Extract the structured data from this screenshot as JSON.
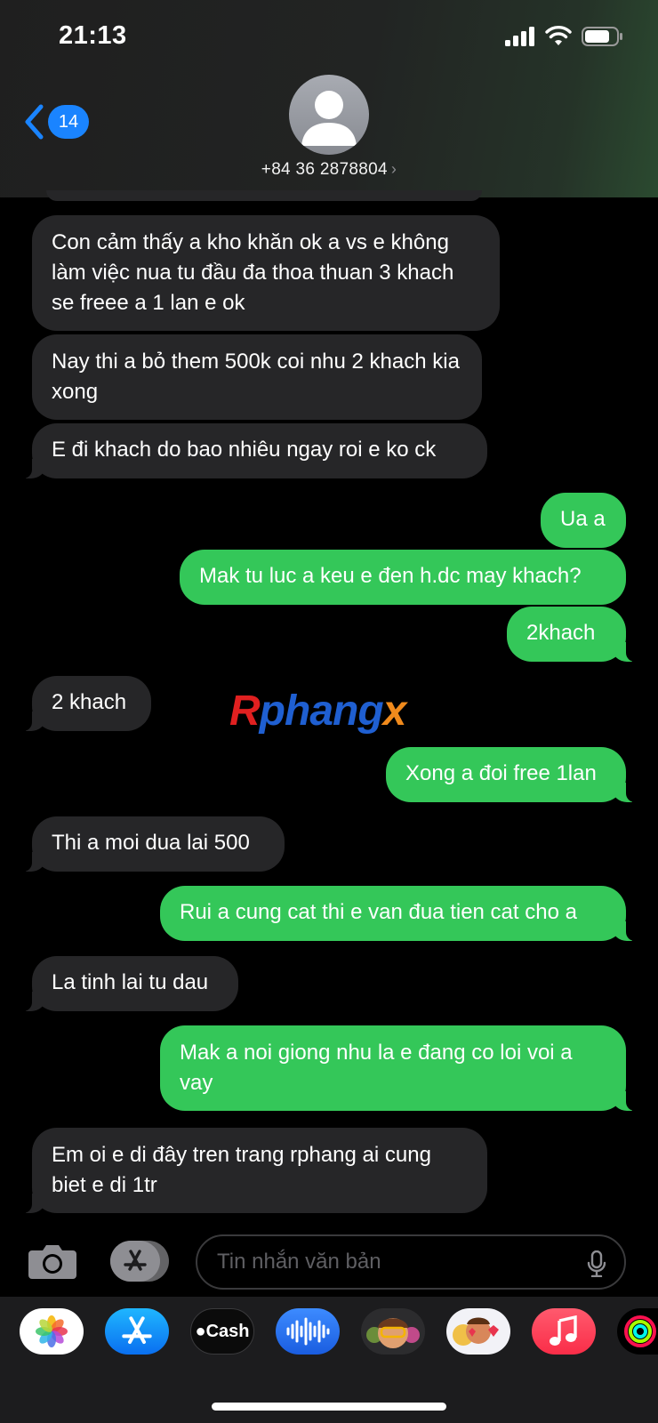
{
  "status": {
    "time": "21:13"
  },
  "header": {
    "back_count": "14",
    "contact": "+84 36 2878804"
  },
  "messages": [
    {
      "dir": "in",
      "text": "Con cảm thấy a kho khăn ok a vs e không làm việc nua tu đầu đa thoa thuan 3 khach se freee a 1 lan e ok"
    },
    {
      "dir": "in",
      "text": "Nay thi a bỏ them 500k coi nhu 2 khach kia xong"
    },
    {
      "dir": "in",
      "text": "E đi khach do bao nhiêu ngay roi e ko ck"
    },
    {
      "dir": "out",
      "text": "Ua a"
    },
    {
      "dir": "out",
      "text": "Mak tu luc a keu e đen h.dc may khach?"
    },
    {
      "dir": "out",
      "text": "2khach"
    },
    {
      "dir": "in",
      "text": "2 khach"
    },
    {
      "dir": "out",
      "text": "Xong a đoi free 1lan"
    },
    {
      "dir": "in",
      "text": "Thi a moi dua lai 500"
    },
    {
      "dir": "out",
      "text": "Rui a cung cat thi e van đua tien cat cho a"
    },
    {
      "dir": "in",
      "text": "La tinh lai tu dau"
    },
    {
      "dir": "out",
      "text": "Mak a noi giong nhu la e đang co loi voi a vay"
    },
    {
      "dir": "in",
      "text": "Em oi e di đây tren trang rphang ai cung biet e di 1tr"
    }
  ],
  "watermark": {
    "r": "R",
    "mid": "phang",
    "x": "x"
  },
  "compose": {
    "placeholder": "Tin nhắn văn bản"
  },
  "tray": {
    "apps": [
      "photos-app",
      "app-store-app",
      "apple-cash-app",
      "audio-message-app",
      "memoji-app",
      "memoji-stickers-app",
      "music-app",
      "fitness-app"
    ],
    "cash_label": "Cash"
  },
  "colors": {
    "incoming": "#262628",
    "outgoing": "#34c759",
    "badge": "#1a84ff"
  }
}
